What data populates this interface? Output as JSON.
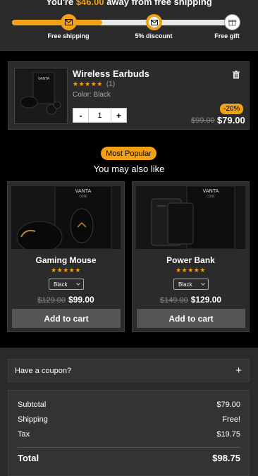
{
  "shipping": {
    "message_prefix": "You're ",
    "amount": "$46.00",
    "message_suffix": " away from free shipping",
    "progress": 0.4,
    "milestones": [
      {
        "label": "Free shipping",
        "icon": "envelope-icon",
        "state": "reached"
      },
      {
        "label": "5% discount",
        "icon": "envelope-icon",
        "state": "next"
      },
      {
        "label": "Free gift",
        "icon": "gift-icon",
        "state": "locked"
      }
    ]
  },
  "cart": {
    "item": {
      "name": "Wireless Earbuds",
      "stars": "★★★★★",
      "review_count": "(1)",
      "color": "Color: Black",
      "quantity": "1",
      "minus": "-",
      "plus": "+",
      "discount": "-20%",
      "old_price": "$99.00",
      "new_price": "$79.00",
      "image_brand": "VANTA"
    }
  },
  "upsell": {
    "badge": "Most Popular",
    "title": "You may also like",
    "products": [
      {
        "name": "Gaming Mouse",
        "stars": "★★★★★",
        "variant": "Black",
        "old_price": "$129.00",
        "new_price": "$99.00",
        "cta": "Add to cart",
        "image_brand": "VANTA",
        "image_sub": "CORE"
      },
      {
        "name": "Power Bank",
        "stars": "★★★★★",
        "variant": "Black",
        "old_price": "$149.00",
        "new_price": "$129.00",
        "cta": "Add to cart",
        "image_brand": "VANTA",
        "image_sub": "CORE"
      }
    ]
  },
  "coupon": {
    "label": "Have a coupon?",
    "toggle": "+"
  },
  "summary": {
    "subtotal_label": "Subtotal",
    "subtotal_value": "$79.00",
    "shipping_label": "Shipping",
    "shipping_value": "Free!",
    "tax_label": "Tax",
    "tax_value": "$19.75",
    "total_label": "Total",
    "total_value": "$98.75"
  },
  "colors": {
    "accent": "#f2a116",
    "panel": "#2a2a2a",
    "card": "#2b2b2b",
    "button": "#555555"
  }
}
